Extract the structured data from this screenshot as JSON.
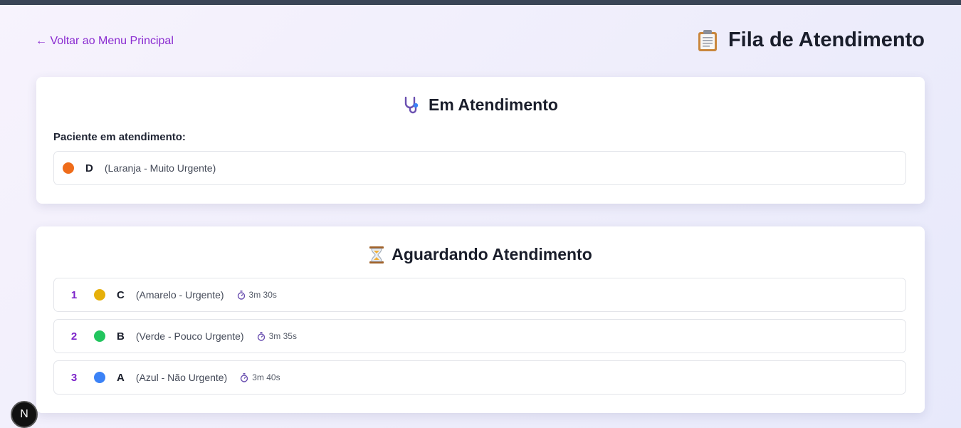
{
  "nav": {
    "back_label": "← Voltar ao Menu Principal"
  },
  "header": {
    "title": "Fila de Atendimento",
    "icon": "clipboard-icon"
  },
  "in_service": {
    "title": "Em Atendimento",
    "icon": "stethoscope-icon",
    "label": "Paciente em atendimento:",
    "patient": {
      "letter": "D",
      "priority": "(Laranja - Muito Urgente)",
      "color": "#ef6c1a"
    }
  },
  "waiting": {
    "title": "Aguardando Atendimento",
    "icon": "hourglass-icon",
    "queue": [
      {
        "position": "1",
        "letter": "C",
        "priority": "(Amarelo - Urgente)",
        "wait": "3m 30s",
        "color": "#e6b00a"
      },
      {
        "position": "2",
        "letter": "B",
        "priority": "(Verde - Pouco Urgente)",
        "wait": "3m 35s",
        "color": "#22c55e"
      },
      {
        "position": "3",
        "letter": "A",
        "priority": "(Azul - Não Urgente)",
        "wait": "3m 40s",
        "color": "#3b82f6"
      }
    ]
  },
  "dev_badge": {
    "label": "N"
  }
}
